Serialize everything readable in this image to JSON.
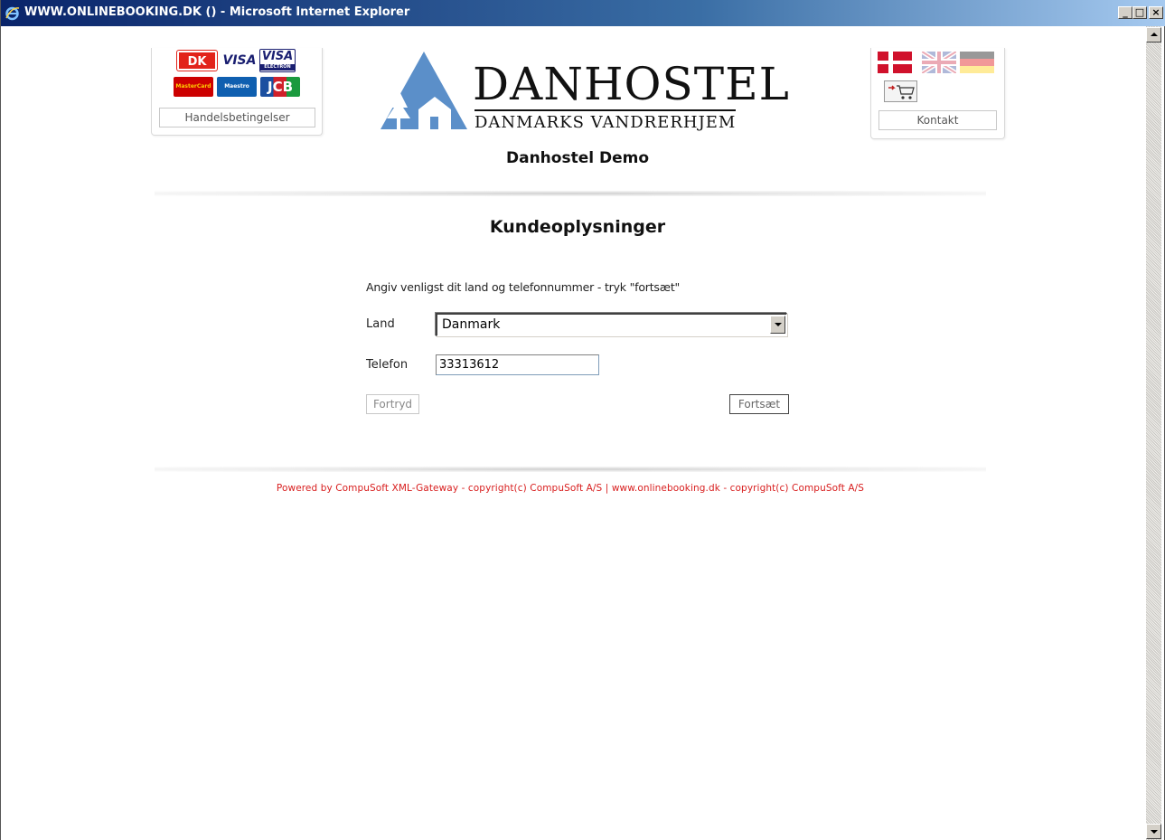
{
  "window": {
    "title": "WWW.ONLINEBOOKING.DK () - Microsoft Internet Explorer",
    "buttons": {
      "minimize": "_",
      "maximize": "□",
      "close": "×"
    }
  },
  "header": {
    "cards": [
      "DK",
      "VISA",
      "VISA",
      "MasterCard",
      "Maestro",
      "JCB"
    ],
    "card_sub": {
      "visa_electron": "ELECTRON"
    },
    "terms_link": "Handelsbetingelser",
    "logo": {
      "main": "DANHOSTEL",
      "sub": "DANMARKS VANDRERHJEM"
    },
    "site_name": "Danhostel Demo",
    "languages": [
      "da",
      "en",
      "de"
    ],
    "cart_icon": "cart-icon",
    "contact_link": "Kontakt"
  },
  "main": {
    "heading": "Kundeoplysninger",
    "instruction": "Angiv venligst dit land og telefonnummer - tryk \"fortsæt\"",
    "country": {
      "label": "Land",
      "value": "Danmark"
    },
    "phone": {
      "label": "Telefon",
      "value": "33313612"
    },
    "cancel_button": "Fortryd",
    "continue_button": "Fortsæt"
  },
  "footer": {
    "text": "Powered by CompuSoft XML-Gateway - copyright(c) CompuSoft A/S  |  www.onlinebooking.dk - copyright(c) CompuSoft A/S"
  },
  "colors": {
    "footer_text": "#d81e1e",
    "logo_blue": "#5b8fc9",
    "title_bar": "#0a246a"
  }
}
